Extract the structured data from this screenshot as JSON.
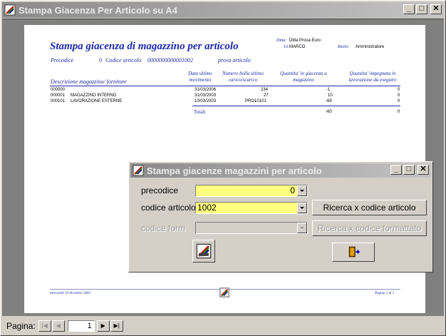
{
  "window": {
    "title": "Stampa Giacenza Per Articolo su A4"
  },
  "report": {
    "title": "Stampa giacenza di magazzino per articolo",
    "ditta_label": "Ditta:",
    "ditta_value": "Ditta Prova Euro",
    "user_label": "Ut:",
    "user_value": "MARCO",
    "ruolo_label": "Ruolo:",
    "ruolo_value": "Amministratore",
    "precodice_label": "Precodice",
    "precodice_value": "0",
    "codice_label": "Codice articolo",
    "codice_value": "0000000000001002",
    "articolo_desc": "prova articolo",
    "columns": [
      "Descrizione magazzino/ fornitore",
      "Data ultimo movimento",
      "Numero bolla ultimo carico/scarico",
      "Quantita' in giacenza a magazzino",
      "Quantita' impegnata in lavorazione da eseguire"
    ],
    "rows": [
      {
        "code": "000000",
        "desc": "",
        "date": "31/03/2006",
        "bolla": "234",
        "qty": "-1",
        "imp": "0"
      },
      {
        "code": "000001",
        "desc": "MAGAZZINO INTERNO",
        "date": "31/03/2003",
        "bolla": "27",
        "qty": "10",
        "imp": "0"
      },
      {
        "code": "000101",
        "desc": "LAVORAZIONE ESTERNE",
        "date": "10/03/2003",
        "bolla": "PRO10101",
        "qty": "-69",
        "imp": "0"
      }
    ],
    "totali_label": "Totali",
    "tot_qty": "-60",
    "tot_imp": "0",
    "footer_date": "mercoledi 10 dicembre 2003",
    "footer_page": "Pagina 1 di 1"
  },
  "statusbar": {
    "label": "Pagina:",
    "page": "1"
  },
  "dialog": {
    "title": "Stampa giacenze magazzini per articolo",
    "precodice_label": "precodice",
    "precodice_value": "0",
    "codice_label": "codice articolo",
    "codice_value": "1002",
    "codice_form_label": "codice form",
    "search_button": "Ricerca x codice articolo",
    "search_form_button": "Ricerca x codice formattato"
  }
}
